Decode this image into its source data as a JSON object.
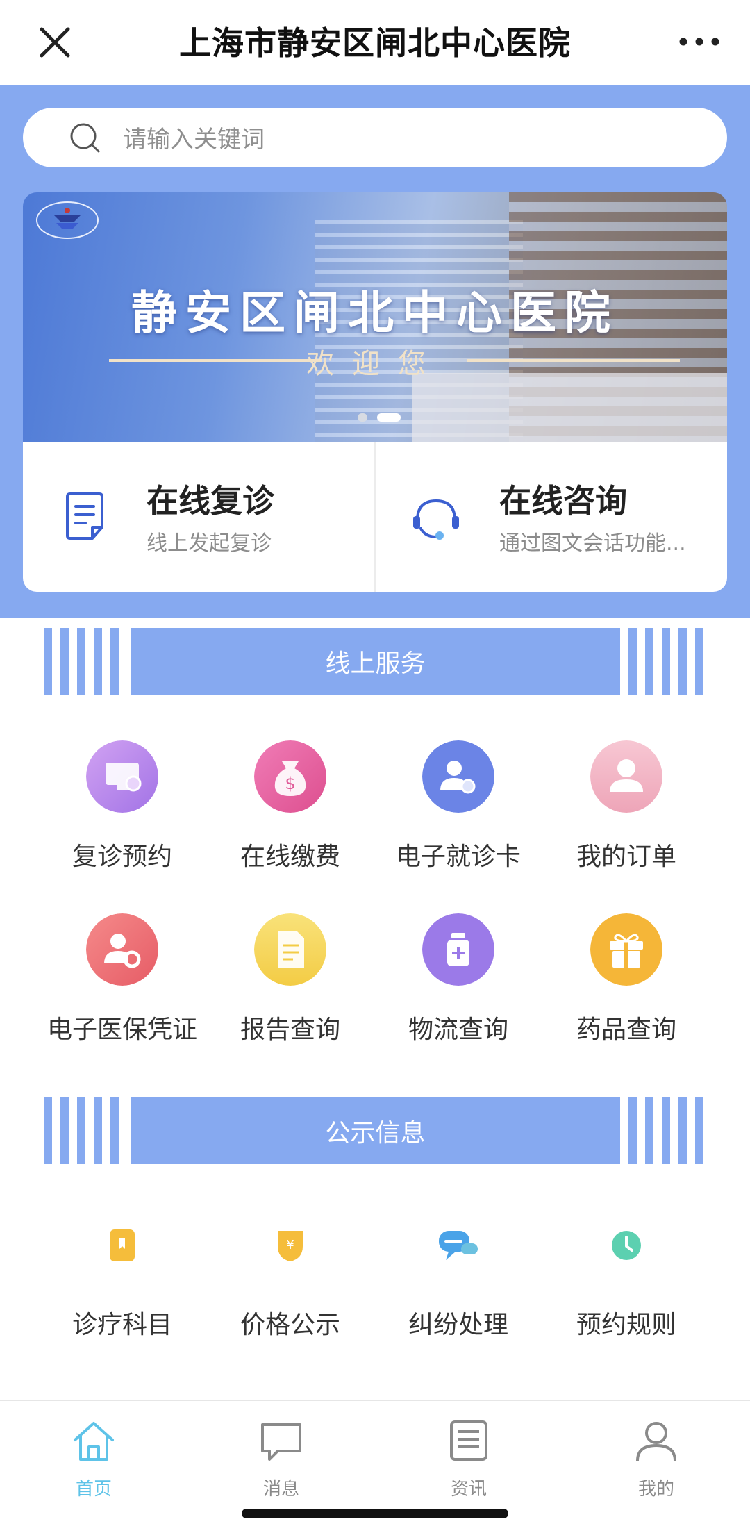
{
  "header": {
    "title": "上海市静安区闸北中心医院",
    "close_icon": "close-icon",
    "more_icon": "more-icon"
  },
  "search": {
    "placeholder": "请输入关键词",
    "icon": "search-icon"
  },
  "banner": {
    "title": "静安区闸北中心医院",
    "subtitle": "欢迎您",
    "slides": 2,
    "active_slide": 2
  },
  "quick_cards": [
    {
      "title": "在线复诊",
      "subtitle": "线上发起复诊",
      "icon": "document-icon"
    },
    {
      "title": "在线咨询",
      "subtitle": "通过图文会话功能...",
      "icon": "headset-icon"
    }
  ],
  "online_services": {
    "section_title": "线上服务",
    "items": [
      {
        "label": "复诊预约",
        "icon": "monitor-icon",
        "color": "#b889ec"
      },
      {
        "label": "在线缴费",
        "icon": "money-bag-icon",
        "color": "#e8609f"
      },
      {
        "label": "电子就诊卡",
        "icon": "user-settings-icon",
        "color": "#6d86e6"
      },
      {
        "label": "我的订单",
        "icon": "user-icon",
        "color": "#f2b7c8"
      },
      {
        "label": "电子医保凭证",
        "icon": "user-gear-icon",
        "color": "#ee6f74"
      },
      {
        "label": "报告查询",
        "icon": "report-icon",
        "color": "#f6d85b"
      },
      {
        "label": "物流查询",
        "icon": "medicine-bottle-icon",
        "color": "#9b7ae8"
      },
      {
        "label": "药品查询",
        "icon": "gift-box-icon",
        "color": "#f5b638"
      }
    ]
  },
  "public_info": {
    "section_title": "公示信息",
    "items": [
      {
        "label": "诊疗科目",
        "icon": "bookmark-icon",
        "color": "#f5bd3b"
      },
      {
        "label": "价格公示",
        "icon": "price-tag-icon",
        "color": "#f5bd3b"
      },
      {
        "label": "纠纷处理",
        "icon": "chat-bubble-icon",
        "color": "#4aa3e8"
      },
      {
        "label": "预约规则",
        "icon": "clock-icon",
        "color": "#5cd0b0"
      }
    ]
  },
  "tabbar": {
    "items": [
      {
        "label": "首页",
        "icon": "home-icon",
        "active": true
      },
      {
        "label": "消息",
        "icon": "message-icon",
        "active": false
      },
      {
        "label": "资讯",
        "icon": "news-icon",
        "active": false
      },
      {
        "label": "我的",
        "icon": "profile-icon",
        "active": false
      }
    ]
  },
  "colors": {
    "primary_blue": "#86a9f0",
    "active_tab": "#5ec3e8"
  }
}
